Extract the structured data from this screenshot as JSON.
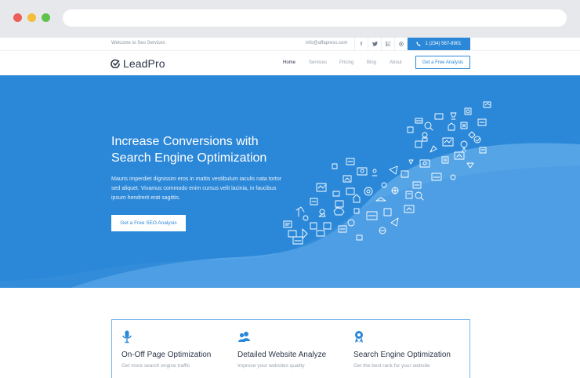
{
  "topbar": {
    "welcome": "Welcome to Seo Services",
    "email": "info@affapress.com",
    "social": [
      {
        "icon": "facebook-icon",
        "glyph": "f"
      },
      {
        "icon": "twitter-icon",
        "glyph": "t"
      },
      {
        "icon": "linkedin-icon",
        "glyph": "in"
      },
      {
        "icon": "globe-icon",
        "glyph": "◎"
      }
    ],
    "phone": "1 (234) 567-8901"
  },
  "nav": {
    "logo": "LeadPro",
    "items": [
      {
        "label": "Home",
        "active": true
      },
      {
        "label": "Services",
        "active": false
      },
      {
        "label": "Pricing",
        "active": false
      },
      {
        "label": "Blog",
        "active": false
      },
      {
        "label": "About",
        "active": false
      }
    ],
    "cta": "Get a Free Analysis"
  },
  "hero": {
    "title_line1": "Increase Conversions with",
    "title_line2": "Search Engine Optimization",
    "text": "Mauris imperdiet dignissim eros in mattis vestibulum iaculis nata tortor sed aliquet. Vivamus commodo enim cursus velit lacinia, in faucibus ipsum hendrerit erat sagittis.",
    "button": "Get a Free SEO Analysis"
  },
  "services": [
    {
      "icon": "microphone-icon",
      "title": "On-Off Page Optimization",
      "subtitle": "Get more search engine traffic"
    },
    {
      "icon": "users-icon",
      "title": "Detailed Website Analyze",
      "subtitle": "Improve your websites quality"
    },
    {
      "icon": "award-icon",
      "title": "Search Engine Optimization",
      "subtitle": "Get the best rank for your website"
    }
  ],
  "colors": {
    "brand": "#2b88d8",
    "hero_light": "#5aa7e8"
  }
}
